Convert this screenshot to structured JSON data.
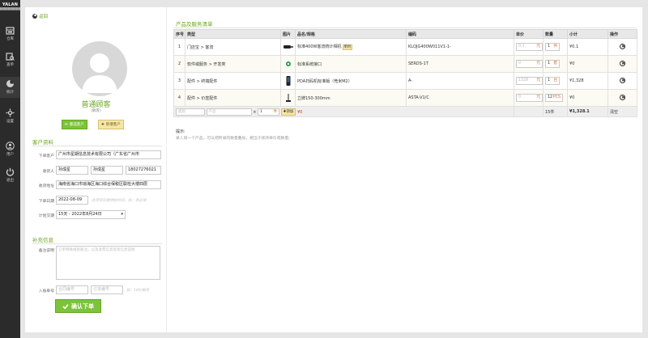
{
  "nav": {
    "logo": "YALAN",
    "logo_sub": "██████████",
    "items": [
      {
        "label": "仓库",
        "icon": "warehouse-icon"
      },
      {
        "label": "查单",
        "icon": "order-search-icon"
      },
      {
        "label": "统计",
        "icon": "chart-pie-icon"
      },
      {
        "label": "设置",
        "icon": "settings-icon"
      },
      {
        "label": "用户",
        "icon": "user-icon"
      },
      {
        "label": "退出",
        "icon": "power-icon"
      }
    ]
  },
  "left": {
    "back_label": "返回",
    "customer_name": "普通顾客",
    "customer_sub": "(散客)",
    "btn_select": "重选客户",
    "btn_new": "新增客户",
    "section_customer": "客户资料",
    "labels": {
      "buyer": "下单客户",
      "contact": "收货人",
      "address": "收货地址",
      "order_date": "下单日期",
      "delivery": "计划交期",
      "remark": "备注说明",
      "ref_no": "入账单号"
    },
    "buyer_value": "广州市星期信息技术有限公司（广东省广州市",
    "contact_name": "孙成星",
    "contact_name2": "孙成星",
    "contact_phone": "18027276021",
    "address_value": "海南省海口市琼海区海口综合保税区联检大楼四层",
    "order_date_value": "2022-08-09",
    "order_date_hint": "此项目仅提供给时间，如：非必填",
    "delivery_value": "15天 - 2022年8月24日",
    "section_extra": "补充信息",
    "remark_placeholder": "订单特殊规则备注，以及发票信息等等信息说明",
    "ref_placeholder1": "合同编号",
    "ref_placeholder2": "订单编号",
    "ref_hint": "如：180/编号",
    "confirm_label": "确认下单"
  },
  "right": {
    "title": "产品及服务清单",
    "columns": [
      "序号",
      "类型",
      "图片",
      "品名/规格",
      "编码",
      "单价",
      "数量",
      "小计",
      "操作"
    ],
    "rows": [
      {
        "no": "1",
        "type": "门店宝 > 客流",
        "name": "标准400W客流统计相机",
        "tag": "单目",
        "code": "KLQJG400W011V1-1-",
        "price": "0.1",
        "unit": "元",
        "qty": "1",
        "qty_unit": "件",
        "subtotal": "¥0.1"
      },
      {
        "no": "2",
        "type": "软件或服务 > 开发类",
        "name": "标准系统接口",
        "tag": "",
        "code": "SERDS-1T",
        "price": "0",
        "unit": "元",
        "qty": "1",
        "qty_unit": "套",
        "subtotal": "¥0"
      },
      {
        "no": "3",
        "type": "配件 > 终端配件",
        "name": "PDA扫码机标准版（竞米M2）",
        "tag": "",
        "code": "A-",
        "price": "1328",
        "unit": "元",
        "qty": "1",
        "qty_unit": "台",
        "subtotal": "¥1,328"
      },
      {
        "no": "4",
        "type": "配件 > 价签配件",
        "name": "立牌150-300mm",
        "tag": "",
        "code": "ASTA-V1/C",
        "price": "0",
        "unit": "元",
        "qty": "12",
        "qty_unit": "PCS",
        "subtotal": "¥0"
      }
    ],
    "footer": {
      "type_ph": "类别",
      "product_ph": "产品",
      "times": "×",
      "qty": "1",
      "qty_unit": "件",
      "add_label": "添加",
      "price": "¥0",
      "count": "15件",
      "total": "¥1,328.1",
      "clear": "清空"
    },
    "tips_title": "提示:",
    "tips_body": "录入同一个产品，可以把所录的数量叠加，相当于修改单价或数量;"
  }
}
